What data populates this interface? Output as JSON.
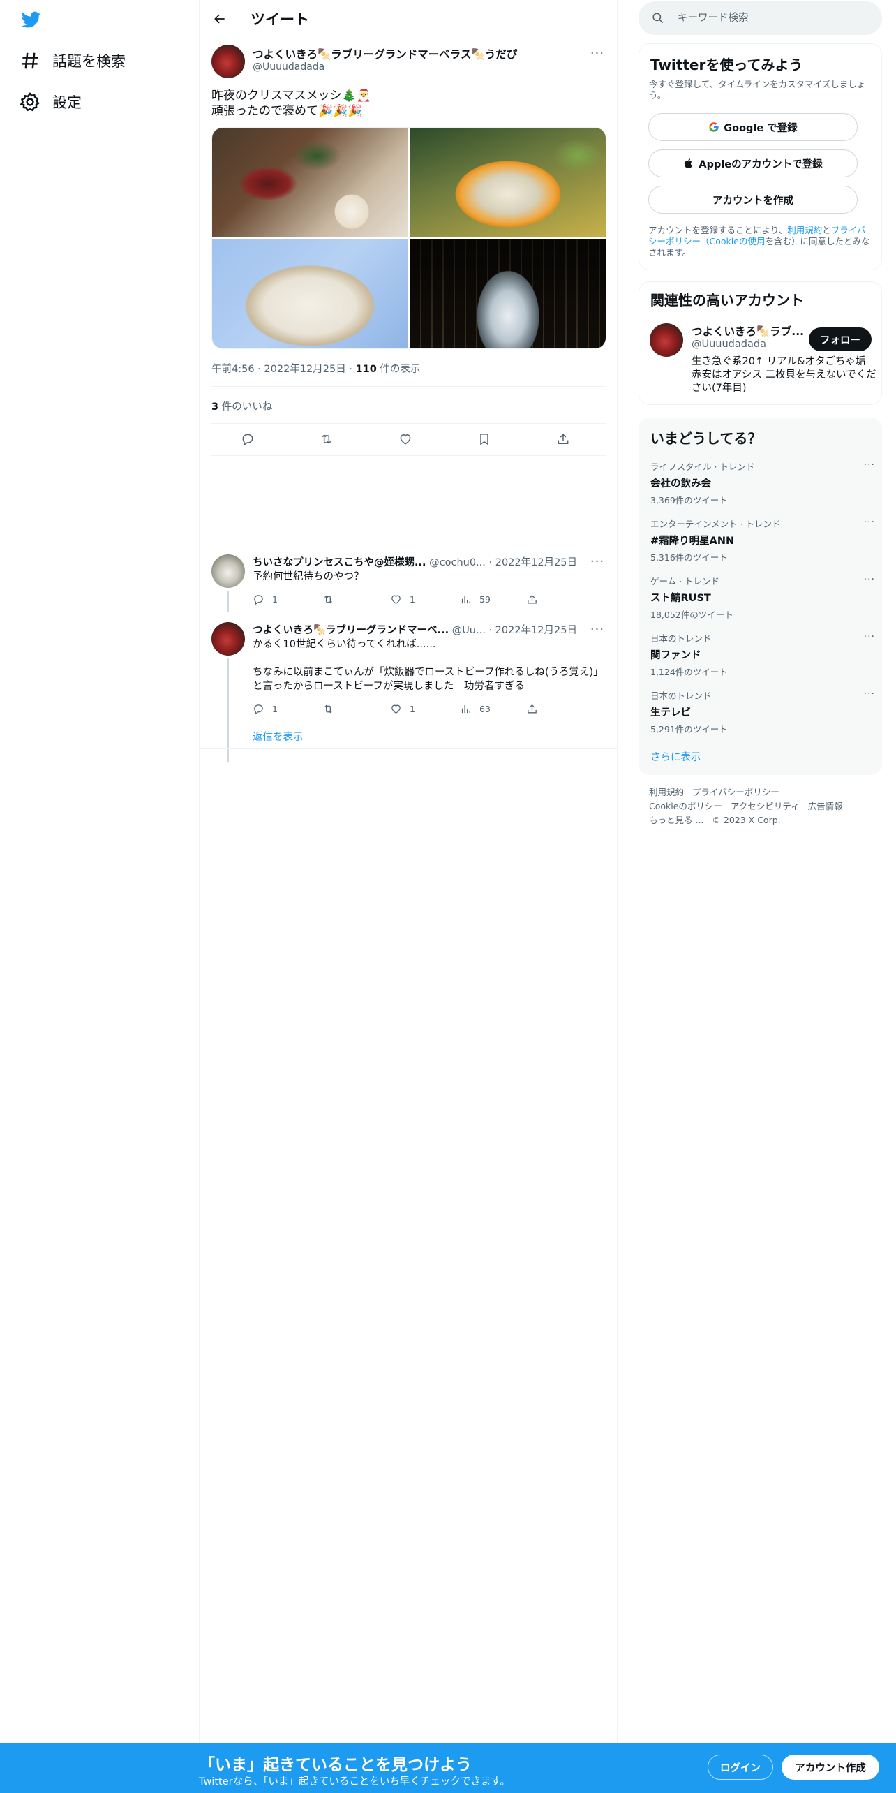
{
  "nav": {
    "explore_label": "話題を検索",
    "settings_label": "設定"
  },
  "header": {
    "title": "ツイート"
  },
  "tweet": {
    "name": "つよくいきろ🍢ラブリーグランドマーベラス🍢うだぴ",
    "handle": "@Uuuudadada",
    "text": "昨夜のクリスマスメッシ🎄🎅\n頑張ったので褒めて🎉🎉🎉",
    "time": "午前4:56",
    "date": "2022年12月25日",
    "views_count": "110",
    "views_label": "件の表示",
    "likes_count": "3",
    "likes_label": "件のいいね"
  },
  "replies": [
    {
      "name": "ちいさなプリンセスこちや@姪様甥...",
      "handle": "@cochu0...",
      "date": "2022年12月25日",
      "text": "予約何世紀待ちのやつ？",
      "reply_count": "1",
      "like_count": "1",
      "view_count": "59"
    },
    {
      "name": "つよくいきろ🍢ラブリーグランドマーベ...",
      "handle": "@Uu...",
      "date": "2022年12月25日",
      "text": "かるく10世紀くらい待ってくれれば......\n\nちなみに以前まこてぃんが「炊飯器でローストビーフ作れるしね(うろ覚え)」と言ったからローストビーフが実現しました　功労者すぎる",
      "reply_count": "1",
      "like_count": "1",
      "view_count": "63"
    }
  ],
  "show_replies": "返信を表示",
  "search": {
    "placeholder": "キーワード検索"
  },
  "signup_card": {
    "title": "Twitterを使ってみよう",
    "subtitle": "今すぐ登録して、タイムラインをカスタマイズしましょう。",
    "google_label": "Google で登録",
    "apple_label": "Appleのアカウントで登録",
    "create_label": "アカウントを作成",
    "legal_prefix": "アカウントを登録することにより、",
    "legal_terms": "利用規約",
    "legal_and": "と",
    "legal_privacy": "プライバシーポリシー",
    "legal_cookie": "（Cookieの使用",
    "legal_suffix": "を含む）に同意したとみなされます。"
  },
  "related_card": {
    "title": "関連性の高いアカウント",
    "name": "つよくいきろ🍢ラブ...",
    "handle": "@Uuuudadada",
    "follow_label": "フォロー",
    "bio": "生き急ぐ系20↑ リアル&オタごちゃ垢 赤安はオアシス 二枚貝を与えないでください(7年目)"
  },
  "trends_card": {
    "title": "いまどうしてる？",
    "items": [
      {
        "context": "ライフスタイル · トレンド",
        "title": "会社の飲み会",
        "count": "3,369件のツイート"
      },
      {
        "context": "エンターテインメント · トレンド",
        "title": "#霜降り明星ANN",
        "count": "5,316件のツイート"
      },
      {
        "context": "ゲーム · トレンド",
        "title": "スト鯖RUST",
        "count": "18,052件のツイート"
      },
      {
        "context": "日本のトレンド",
        "title": "関ファンド",
        "count": "1,124件のツイート"
      },
      {
        "context": "日本のトレンド",
        "title": "生テレビ",
        "count": "5,291件のツイート"
      }
    ],
    "show_more": "さらに表示"
  },
  "footer": {
    "terms": "利用規約",
    "privacy": "プライバシーポリシー",
    "cookie": "Cookieのポリシー",
    "accessibility": "アクセシビリティ",
    "ads": "広告情報",
    "more": "もっと見る ...",
    "copyright": "© 2023 X Corp."
  },
  "bottom_bar": {
    "title": "「いま」起きていることを見つけよう",
    "subtitle": "Twitterなら、「いま」起きていることをいち早くチェックできます。",
    "login_label": "ログイン",
    "signup_label": "アカウント作成"
  },
  "colors": {
    "accent": "#1d9bf0",
    "text": "#0f1419",
    "secondary": "#536471"
  }
}
